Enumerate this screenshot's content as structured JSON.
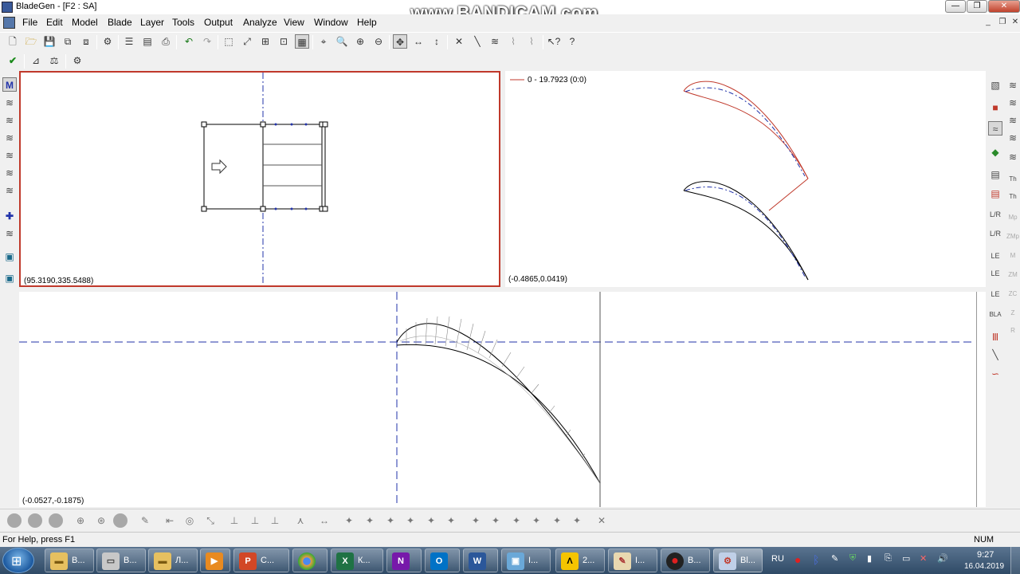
{
  "window": {
    "title": "BladeGen - [F2 : SA]"
  },
  "watermark": "www.BANDICAM.com",
  "menu": [
    "File",
    "Edit",
    "Model",
    "Blade",
    "Layer",
    "Tools",
    "Output",
    "Analyze",
    "View",
    "Window",
    "Help"
  ],
  "panels": {
    "meridional": {
      "coord": "(95.3190,335.5488)"
    },
    "blade_to_blade": {
      "coord": "(-0.4865,0.0419)",
      "legend": "0 - 19.7923 (0:0)"
    },
    "thickness": {
      "coord": "(-0.0527,-0.1875)"
    }
  },
  "status": {
    "help": "For Help, press F1",
    "mode": "NUM"
  },
  "taskbar": {
    "buttons": [
      {
        "icon": "folder-icon",
        "label": "В..."
      },
      {
        "icon": "drive-icon",
        "label": "В..."
      },
      {
        "icon": "folder-icon",
        "label": "Л..."
      },
      {
        "icon": "media-icon",
        "label": ""
      },
      {
        "icon": "powerpoint-icon",
        "label": "С..."
      },
      {
        "icon": "chrome-icon",
        "label": ""
      },
      {
        "icon": "excel-icon",
        "label": "К..."
      },
      {
        "icon": "onenote-icon",
        "label": ""
      },
      {
        "icon": "outlook-icon",
        "label": ""
      },
      {
        "icon": "word-icon",
        "label": ""
      },
      {
        "icon": "image-icon",
        "label": "I..."
      },
      {
        "icon": "archicad-icon",
        "label": "2..."
      },
      {
        "icon": "paint-icon",
        "label": "I..."
      },
      {
        "icon": "record-icon",
        "label": "В..."
      },
      {
        "icon": "bladegen-icon",
        "label": "Bl..."
      }
    ],
    "language": "RU",
    "time": "9:27",
    "date": "16.04.2019"
  },
  "colors": {
    "red_accent": "#c0392b",
    "axis_blue": "#2233aa"
  }
}
